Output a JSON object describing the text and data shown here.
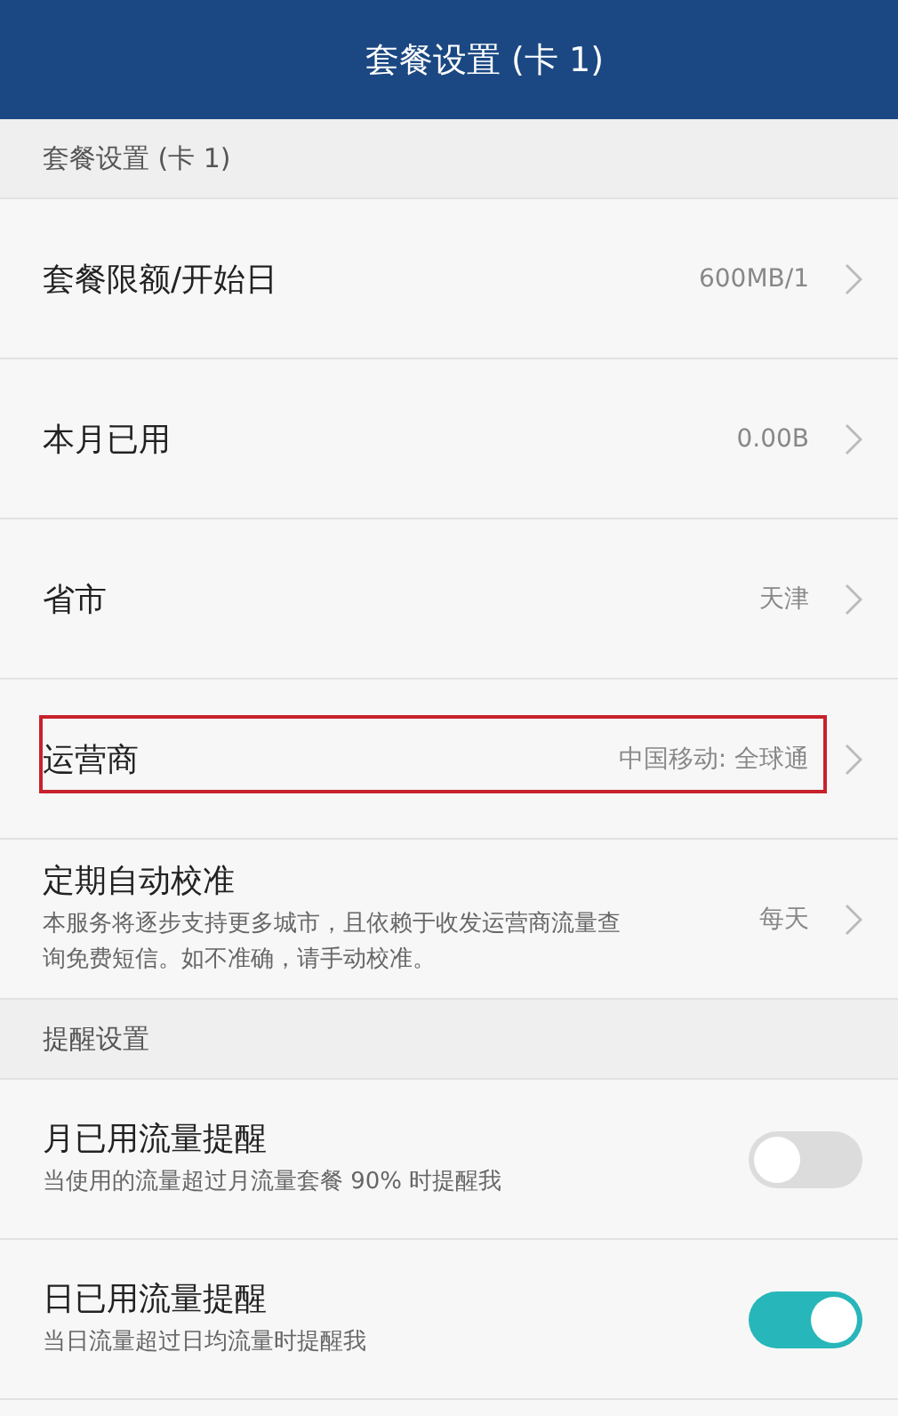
{
  "title_bar": {
    "title": "套餐设置 (卡 1)"
  },
  "sections": [
    {
      "header": "套餐设置 (卡 1)",
      "rows": [
        {
          "kind": "nav",
          "label": "套餐限额/开始日",
          "value": "600MB/1",
          "highlighted": false
        },
        {
          "kind": "nav",
          "label": "本月已用",
          "value": "0.00B",
          "highlighted": false
        },
        {
          "kind": "nav",
          "label": "省市",
          "value": "天津",
          "highlighted": false
        },
        {
          "kind": "nav",
          "label": "运营商",
          "value": "中国移动: 全球通",
          "highlighted": true
        },
        {
          "kind": "nav",
          "label": "定期自动校准",
          "description": "本服务将逐步支持更多城市，且依赖于收发运营商流量查询免费短信。如不准确，请手动校准。",
          "value": "每天",
          "highlighted": false
        }
      ]
    },
    {
      "header": "提醒设置",
      "rows": [
        {
          "kind": "toggle",
          "label": "月已用流量提醒",
          "description": "当使用的流量超过月流量套餐 90% 时提醒我",
          "on": false
        },
        {
          "kind": "toggle",
          "label": "日已用流量提醒",
          "description": "当日流量超过日均流量时提醒我",
          "on": true
        }
      ]
    }
  ]
}
